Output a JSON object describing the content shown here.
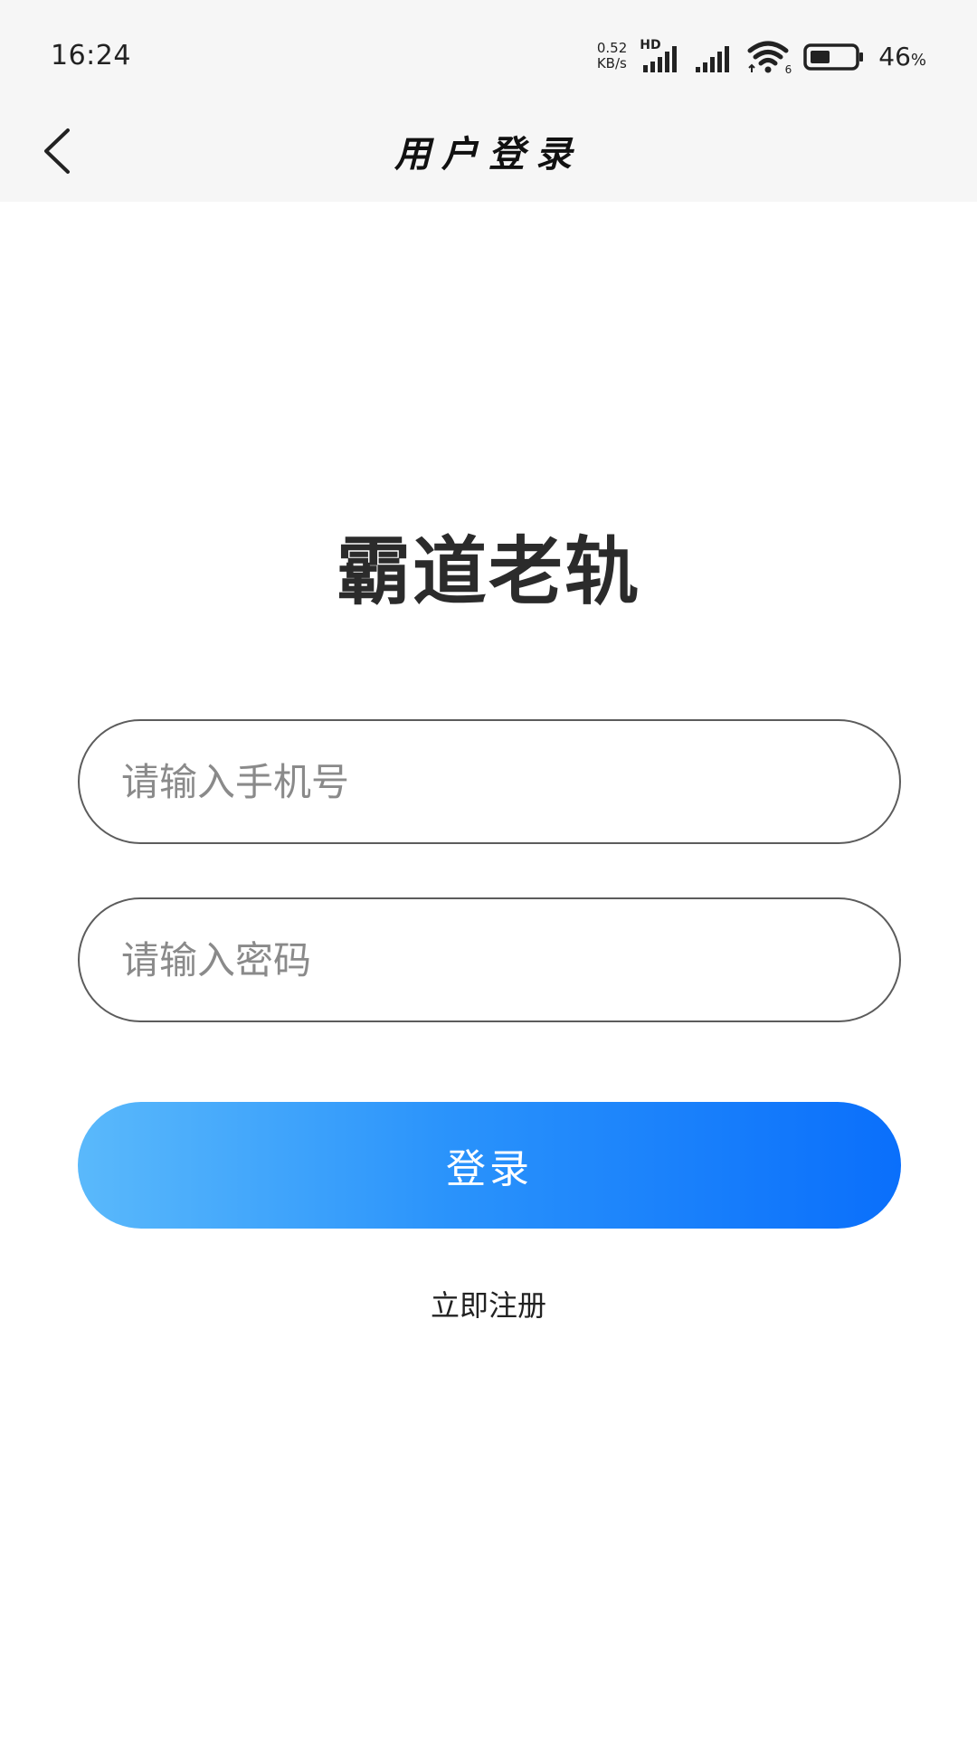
{
  "status_bar": {
    "time": "16:24",
    "net_speed_value": "0.52",
    "net_speed_unit": "KB/s",
    "network_type": "HD",
    "wifi_badge": "6",
    "battery_level": 46,
    "battery_percent_number": "46",
    "battery_percent_sign": "%"
  },
  "nav": {
    "title": "用户登录"
  },
  "app": {
    "title": "霸道老轨"
  },
  "form": {
    "phone_placeholder": "请输入手机号",
    "phone_value": "",
    "password_placeholder": "请输入密码",
    "password_value": "",
    "login_label": "登录",
    "register_label": "立即注册"
  },
  "colors": {
    "accent_start": "#5ab9fb",
    "accent_end": "#0a6ffb",
    "bar_background": "#f6f6f6"
  }
}
